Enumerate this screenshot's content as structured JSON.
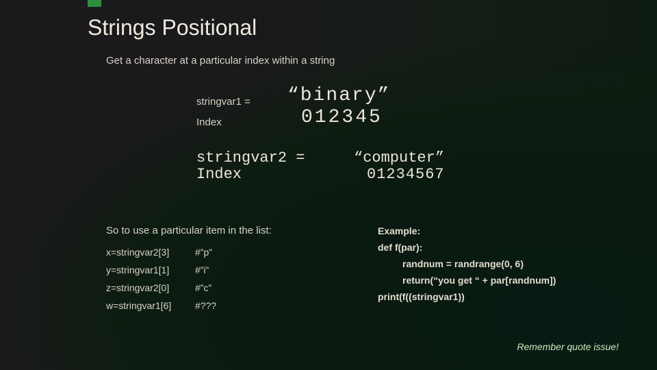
{
  "title": "Strings Positional",
  "subtitle": "Get a character at a particular index within a string",
  "example1": {
    "assign_label": "stringvar1 =",
    "assign_value": "“binary”",
    "index_label": "Index",
    "index_value": "012345"
  },
  "example2": {
    "assign_label": "stringvar2 =",
    "assign_value": "“computer”",
    "index_label": "Index",
    "index_value": "01234567"
  },
  "usage_heading": "So to use a particular item in the list:",
  "usage_rows": [
    {
      "code": "x=stringvar2[3]",
      "comment": "#”p”"
    },
    {
      "code": "y=stringvar1[1]",
      "comment": "#”i”"
    },
    {
      "code": "z=stringvar2[0]",
      "comment": "#”c”"
    },
    {
      "code": "w=stringvar1[6]",
      "comment": "#???"
    }
  ],
  "code_example": {
    "heading": "Example:",
    "lines": [
      "def f(par):",
      "randnum = randrange(0, 6)",
      "return(“you get “ + par[randnum])",
      "print(f((stringvar1))"
    ]
  },
  "footnote": "Remember quote issue!"
}
